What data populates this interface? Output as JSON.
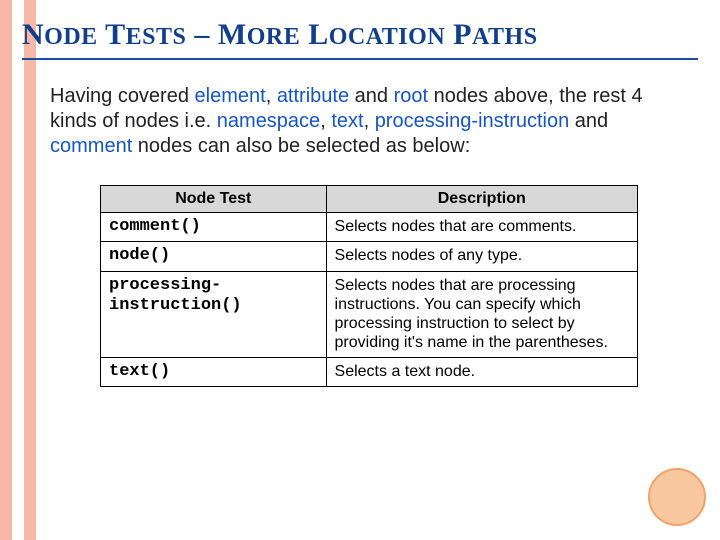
{
  "title_parts": {
    "node": "N",
    "ode": "ODE",
    "tests": "T",
    "ests": "ESTS",
    "dash": " – ",
    "more": "M",
    "ore": "ORE",
    "location": "L",
    "ocation": "OCATION",
    "paths": "P",
    "aths": "ATHS"
  },
  "title_plain": "Node Tests – More Location Paths",
  "para": {
    "t1": "Having covered ",
    "kw1": "element",
    "t2": ", ",
    "kw2": "attribute",
    "t3": " and ",
    "kw3": "root",
    "t4": " nodes above, the rest 4 kinds of nodes i.e. ",
    "kw4": "namespace",
    "t5": ", ",
    "kw5": "text",
    "t6": ", ",
    "kw6": "processing-instruction",
    "t7": " and ",
    "kw7": "comment",
    "t8": " nodes can also be selected as below:"
  },
  "table": {
    "headers": {
      "c1": "Node Test",
      "c2": "Description"
    },
    "rows": [
      {
        "test": "comment()",
        "desc": "Selects nodes that are comments."
      },
      {
        "test": "node()",
        "desc": "Selects nodes of any type."
      },
      {
        "test": "processing-instruction()",
        "desc": "Selects nodes that are processing instructions. You can specify which processing instruction to select by providing it's name in the parentheses."
      },
      {
        "test": "text()",
        "desc": "Selects a text node."
      }
    ]
  }
}
